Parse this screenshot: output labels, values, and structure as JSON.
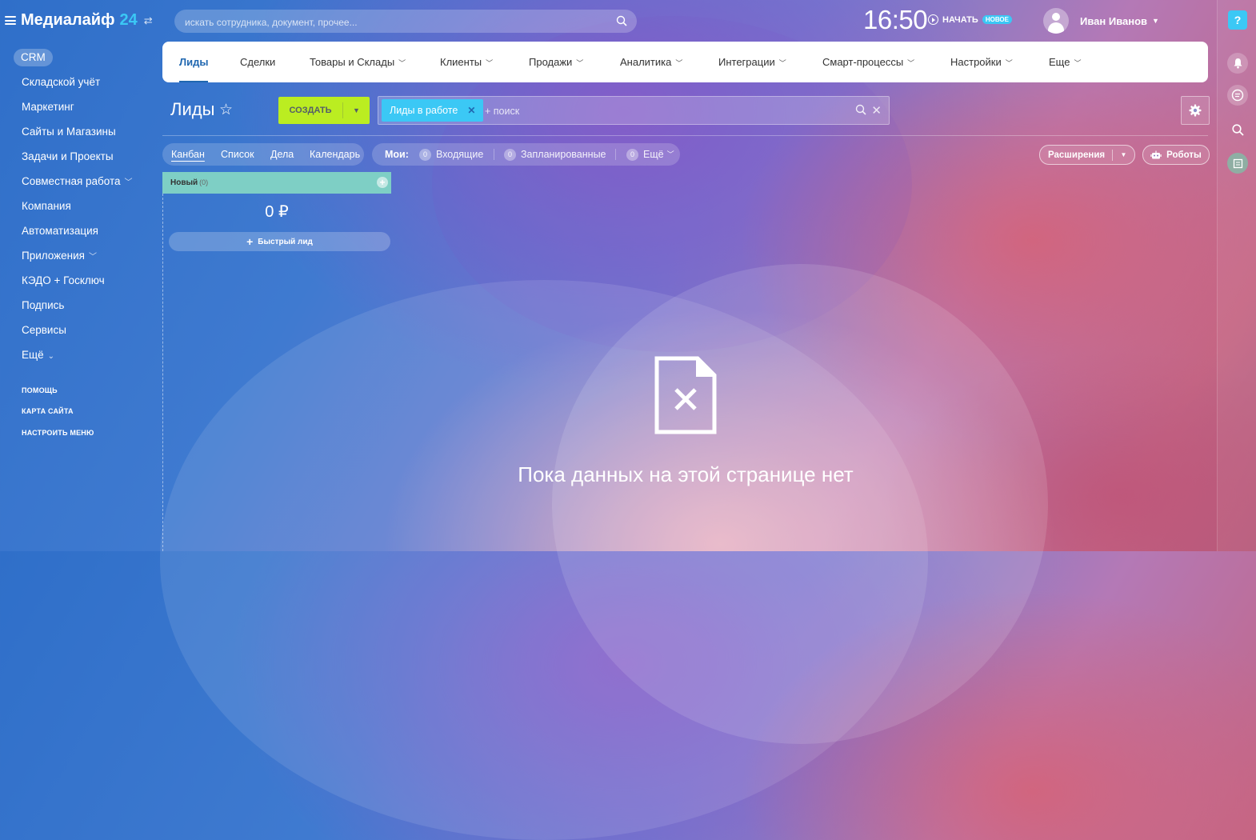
{
  "app": {
    "name": "Медиалайф",
    "number": "24"
  },
  "search": {
    "placeholder": "искать сотрудника, документ, прочее..."
  },
  "header": {
    "time": "16:50",
    "start_label": "НАЧАТЬ",
    "new_badge": "НОВОЕ",
    "user_name": "Иван Иванов"
  },
  "sidebar": {
    "items": [
      {
        "label": "CRM"
      },
      {
        "label": "Складской учёт"
      },
      {
        "label": "Маркетинг"
      },
      {
        "label": "Сайты и Магазины"
      },
      {
        "label": "Задачи и Проекты"
      },
      {
        "label": "Совместная работа"
      },
      {
        "label": "Компания"
      },
      {
        "label": "Автоматизация"
      },
      {
        "label": "Приложения"
      },
      {
        "label": "КЭДО + Госключ"
      },
      {
        "label": "Подпись"
      },
      {
        "label": "Сервисы"
      },
      {
        "label": "Ещё"
      }
    ],
    "links": [
      {
        "label": "ПОМОЩЬ"
      },
      {
        "label": "КАРТА САЙТА"
      },
      {
        "label": "НАСТРОИТЬ МЕНЮ"
      }
    ]
  },
  "tabs": [
    {
      "label": "Лиды"
    },
    {
      "label": "Сделки"
    },
    {
      "label": "Товары и Склады"
    },
    {
      "label": "Клиенты"
    },
    {
      "label": "Продажи"
    },
    {
      "label": "Аналитика"
    },
    {
      "label": "Интеграции"
    },
    {
      "label": "Смарт-процессы"
    },
    {
      "label": "Настройки"
    },
    {
      "label": "Еще"
    }
  ],
  "toolbar": {
    "title": "Лиды",
    "create_label": "СОЗДАТЬ",
    "filter_chip": "Лиды в работе",
    "filter_placeholder": "+ поиск"
  },
  "views": {
    "items": [
      {
        "label": "Канбан"
      },
      {
        "label": "Список"
      },
      {
        "label": "Дела"
      },
      {
        "label": "Календарь"
      }
    ],
    "mine_label": "Мои:",
    "counters": [
      {
        "count": "0",
        "label": "Входящие"
      },
      {
        "count": "0",
        "label": "Запланированные"
      },
      {
        "count": "0",
        "label": "Ещё"
      }
    ],
    "extensions_label": "Расширения",
    "robots_label": "Роботы"
  },
  "kanban": {
    "stage_name": "Новый",
    "stage_count": "(0)",
    "stage_color": "#7ecfc5",
    "sum": "0 ₽",
    "quick_label": "Быстрый лид"
  },
  "empty_state": {
    "text": "Пока данных на этой странице нет"
  },
  "colors": {
    "accent": "#3bc8f5",
    "create_button": "#bbed21",
    "active_tab": "#2067b0"
  }
}
